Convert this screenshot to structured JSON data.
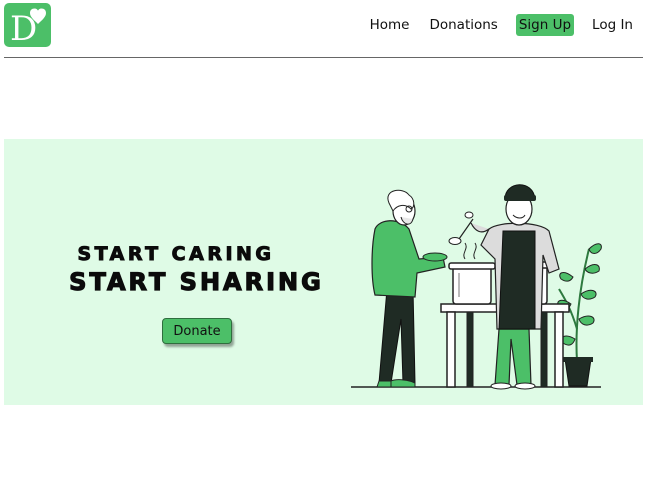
{
  "header": {
    "logo": {
      "letter": "D",
      "icon": "heart-icon",
      "color": "#4cbf68"
    },
    "nav": [
      {
        "label": "Home"
      },
      {
        "label": "Donations"
      },
      {
        "label": "Sign Up",
        "highlight": true
      },
      {
        "label": "Log In"
      }
    ]
  },
  "hero": {
    "tagline_line1": "START CARING",
    "tagline_line2": "START SHARING",
    "donate_label": "Donate",
    "illustration": "charity-food-sharing-illustration",
    "background": "#dffbe6",
    "accent": "#4cbf68"
  }
}
